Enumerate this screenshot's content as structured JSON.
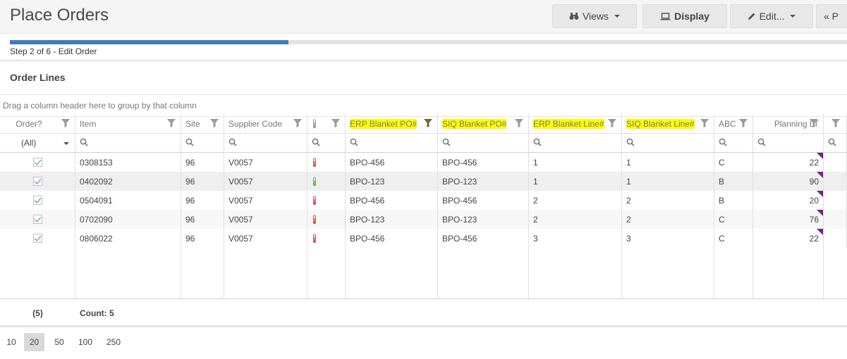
{
  "header": {
    "title": "Place Orders",
    "buttons": [
      {
        "label": "Views",
        "icon": "binoculars-icon"
      },
      {
        "label": "Display",
        "icon": "laptop-icon"
      },
      {
        "label": "Edit...",
        "icon": "pencil-icon"
      },
      {
        "label": "« P",
        "icon": ""
      }
    ]
  },
  "progress": {
    "text": "Step 2 of 6 - Edit Order",
    "fraction": 0.333
  },
  "panel": {
    "title": "Order Lines",
    "group_hint": "Drag a column header here to group by that column"
  },
  "grid": {
    "columns": [
      "Order?",
      "Item",
      "Site",
      "Supplier Code",
      "",
      "ERP Blanket PO#",
      "SIQ Blanket PO#",
      "ERP Blanket Line#",
      "SIQ Blanket Line#",
      "ABC",
      "Planning LT"
    ],
    "highlighted_columns": [
      "ERP Blanket PO#",
      "SIQ Blanket PO#",
      "ERP Blanket Line#",
      "SIQ Blanket Line#"
    ],
    "highlight_color": "#ffff00",
    "filter_order_value": "(All)",
    "rows": [
      {
        "order": true,
        "item": "0308153",
        "site": "96",
        "supplier": "V0057",
        "status": "red",
        "erp_po": "BPO-456",
        "siq_po": "BPO-456",
        "erp_line": "1",
        "siq_line": "1",
        "abc": "C",
        "planning_lt": "22"
      },
      {
        "order": true,
        "item": "0402092",
        "site": "96",
        "supplier": "V0057",
        "status": "green",
        "erp_po": "BPO-123",
        "siq_po": "BPO-123",
        "erp_line": "1",
        "siq_line": "1",
        "abc": "B",
        "planning_lt": "90"
      },
      {
        "order": true,
        "item": "0504091",
        "site": "96",
        "supplier": "V0057",
        "status": "red",
        "erp_po": "BPO-456",
        "siq_po": "BPO-456",
        "erp_line": "2",
        "siq_line": "2",
        "abc": "B",
        "planning_lt": "20"
      },
      {
        "order": true,
        "item": "0702090",
        "site": "96",
        "supplier": "V0057",
        "status": "red",
        "erp_po": "BPO-123",
        "siq_po": "BPO-123",
        "erp_line": "2",
        "siq_line": "2",
        "abc": "C",
        "planning_lt": "76"
      },
      {
        "order": true,
        "item": "0806022",
        "site": "96",
        "supplier": "V0057",
        "status": "red",
        "erp_po": "BPO-456",
        "siq_po": "BPO-456",
        "erp_line": "3",
        "siq_line": "3",
        "abc": "C",
        "planning_lt": "22"
      }
    ],
    "footer": {
      "order_count": "(5)",
      "item_count": "Count: 5"
    }
  },
  "pager": {
    "sizes": [
      "10",
      "20",
      "50",
      "100",
      "250"
    ],
    "active": "20"
  },
  "colors": {
    "progress": "#3f7bbf",
    "marker": "#7a1e8a",
    "status_red": "#d9534f",
    "status_green": "#5cb85c"
  }
}
